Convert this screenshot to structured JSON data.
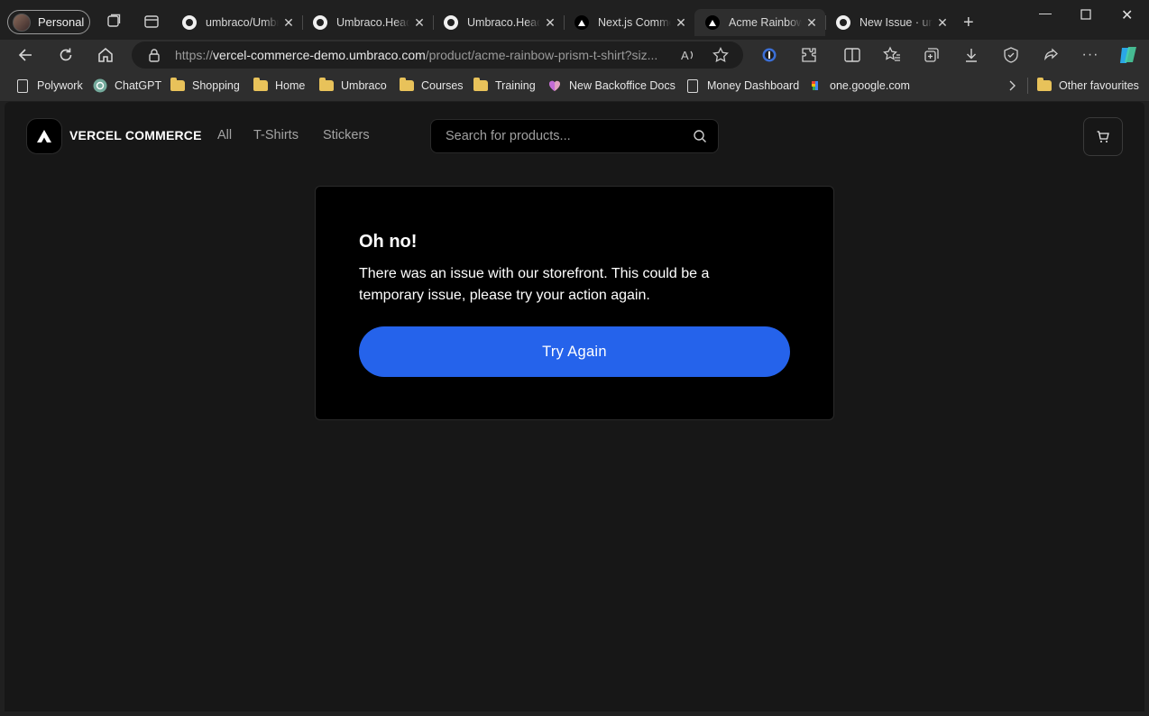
{
  "browser": {
    "profile_label": "Personal",
    "tabs": [
      {
        "title": "umbraco/Umbraco",
        "icon": "github-icon"
      },
      {
        "title": "Umbraco.Headless",
        "icon": "github-icon"
      },
      {
        "title": "Umbraco.Headless",
        "icon": "github-icon"
      },
      {
        "title": "Next.js Commerce",
        "icon": "vercel-icon"
      },
      {
        "title": "Acme Rainbow Prism",
        "icon": "vercel-icon",
        "active": true
      },
      {
        "title": "New Issue · umbraco",
        "icon": "github-icon"
      }
    ],
    "new_tab": "+",
    "url": {
      "scheme": "https://",
      "host": "vercel-commerce-demo.umbraco.com",
      "path": "/product/acme-rainbow-prism-t-shirt?siz..."
    },
    "bookmarks": [
      {
        "label": "Polywork",
        "icon": "page-icon"
      },
      {
        "label": "ChatGPT",
        "icon": "chatgpt-icon"
      },
      {
        "label": "Shopping",
        "icon": "folder-icon"
      },
      {
        "label": "Home",
        "icon": "folder-icon"
      },
      {
        "label": "Umbraco",
        "icon": "folder-icon"
      },
      {
        "label": "Courses",
        "icon": "folder-icon"
      },
      {
        "label": "Training",
        "icon": "folder-icon"
      },
      {
        "label": "New Backoffice Docs",
        "icon": "heart-icon"
      },
      {
        "label": "Money Dashboard",
        "icon": "page-icon"
      },
      {
        "label": "one.google.com",
        "icon": "google-one-icon"
      }
    ],
    "other_favourites": "Other favourites"
  },
  "site": {
    "brand": "VERCEL COMMERCE",
    "nav": [
      "All",
      "T-Shirts",
      "Stickers"
    ],
    "search_placeholder": "Search for products...",
    "error": {
      "title": "Oh no!",
      "message": "There was an issue with our storefront. This could be a temporary issue, please try your action again.",
      "button": "Try Again"
    },
    "accent_color": "#2563eb"
  }
}
